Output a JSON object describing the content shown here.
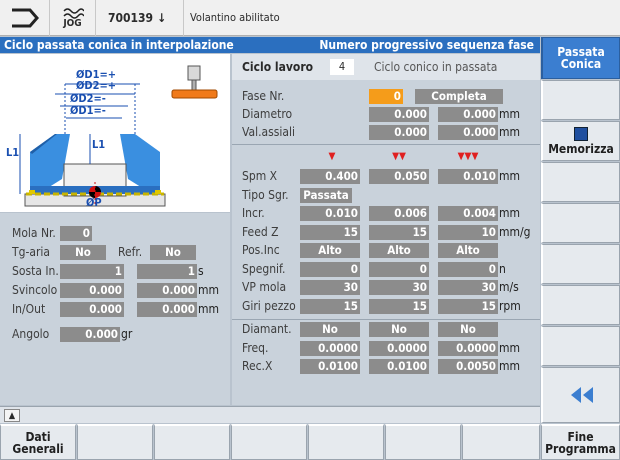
{
  "topbar": {
    "mode": "JOG",
    "program": "700139",
    "message": "Volantino abilitato"
  },
  "title": {
    "left": "Ciclo passata conica in interpolazione",
    "right": "Numero progressivo sequenza fase"
  },
  "drawing": {
    "d1_plus": "ØD1=+",
    "d2_plus": "ØD2=+",
    "d2_minus": "ØD2=-",
    "d1_minus": "ØD1=-",
    "l1_left": "L1",
    "l1_inner": "L1",
    "p_label": "ØP"
  },
  "left": {
    "mola_label": "Mola Nr.",
    "mola_value": "0",
    "tg_label": "Tg-aria",
    "tg_value": "No",
    "refr_label": "Refr.",
    "refr_value": "No",
    "sosta_label": "Sosta In.",
    "sosta_v1": "1",
    "sosta_v2": "1",
    "sosta_unit": "s",
    "svincolo_label": "Svincolo",
    "svincolo_v1": "0.000",
    "svincolo_v2": "0.000",
    "svincolo_unit": "mm",
    "inout_label": "In/Out",
    "inout_v1": "0.000",
    "inout_v2": "0.000",
    "inout_unit": "mm",
    "angolo_label": "Angolo",
    "angolo_value": "0.000",
    "angolo_unit": "gr"
  },
  "right": {
    "ciclo_label": "Ciclo lavoro",
    "ciclo_value": "4",
    "ciclo_desc": "Ciclo conico in passata",
    "fase_label": "Fase Nr.",
    "fase_value": "0",
    "fase_status": "Completa",
    "diametro_label": "Diametro",
    "diametro_v1": "0.000",
    "diametro_v2": "0.000",
    "diametro_unit": "mm",
    "valassiali_label": "Val.assiali",
    "valassiali_v1": "0.000",
    "valassiali_v2": "0.000",
    "valassiali_unit": "mm",
    "tri1": "▼",
    "tri2": "▼▼",
    "tri3": "▼▼▼",
    "rows": [
      {
        "label": "Spm X",
        "v": [
          "0.400",
          "0.050",
          "0.010"
        ],
        "unit": "mm"
      },
      {
        "label": "Tipo Sgr.",
        "v": [
          "Passata"
        ],
        "unit": ""
      },
      {
        "label": "Incr.",
        "v": [
          "0.010",
          "0.006",
          "0.004"
        ],
        "unit": "mm"
      },
      {
        "label": "Feed Z",
        "v": [
          "15",
          "15",
          "10"
        ],
        "unit": "mm/g"
      },
      {
        "label": "Pos.Inc",
        "v": [
          "Alto",
          "Alto",
          "Alto"
        ],
        "unit": ""
      },
      {
        "label": "Spegnif.",
        "v": [
          "0",
          "0",
          "0"
        ],
        "unit": "n"
      },
      {
        "label": "VP mola",
        "v": [
          "30",
          "30",
          "30"
        ],
        "unit": "m/s"
      },
      {
        "label": "Giri pezzo",
        "v": [
          "15",
          "15",
          "15"
        ],
        "unit": "rpm"
      },
      {
        "label": "Diamant.",
        "v": [
          "No",
          "No",
          "No"
        ],
        "unit": ""
      },
      {
        "label": "Freq.",
        "v": [
          "0.0000",
          "0.0000",
          "0.0000"
        ],
        "unit": "mm"
      },
      {
        "label": "Rec.X",
        "v": [
          "0.0100",
          "0.0100",
          "0.0050"
        ],
        "unit": "mm"
      }
    ]
  },
  "softkeys_right": {
    "k1": "Passata\nConica",
    "k5": "Memorizza"
  },
  "softkeys_bottom": {
    "b1": "Dati\nGenerali",
    "b8": "Fine\nProgramma"
  },
  "colors": {
    "title_bar": "#2b6fbf",
    "field": "#8c8c8c",
    "highlight": "#f59c1a",
    "active_softkey": "#3b7ed0"
  }
}
